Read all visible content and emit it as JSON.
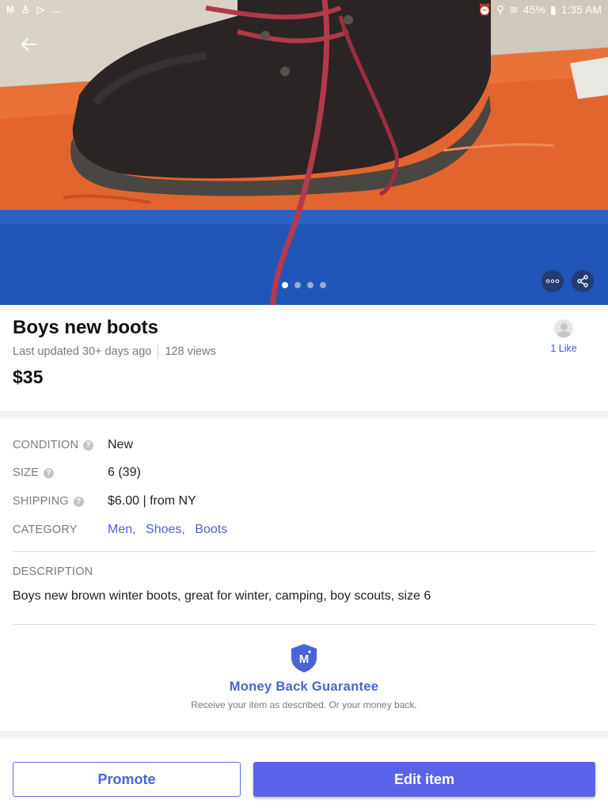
{
  "status_bar": {
    "left_icons": [
      "gmail-icon",
      "person-icon",
      "play-icon",
      "more-notifications-icon"
    ],
    "battery": "45%",
    "time": "1:35 AM"
  },
  "gallery": {
    "image_subject": "brown boot with red laces on orange shoe box",
    "dot_count": 4,
    "active_dot": 0
  },
  "listing": {
    "title": "Boys new boots",
    "updated": "Last updated 30+ days ago",
    "views": "128 views",
    "price": "$35",
    "likes": "1 Like"
  },
  "details": {
    "condition_label": "CONDITION",
    "condition_value": "New",
    "size_label": "SIZE",
    "size_value": "6 (39)",
    "shipping_label": "SHIPPING",
    "shipping_value": "$6.00 | from NY",
    "category_label": "CATEGORY",
    "categories": [
      "Men,",
      "Shoes,",
      "Boots"
    ]
  },
  "description": {
    "label": "DESCRIPTION",
    "text": "Boys new brown winter boots, great for winter, camping, boy scouts, size 6"
  },
  "guarantee": {
    "badge_letter": "M",
    "title": "Money Back Guarantee",
    "subtitle": "Receive your item as described. Or your money back."
  },
  "actions": {
    "promote": "Promote",
    "edit": "Edit item"
  },
  "colors": {
    "accent": "#4a63d6",
    "button_primary": "#5b63ea",
    "muted_text": "#7a7a7a"
  }
}
